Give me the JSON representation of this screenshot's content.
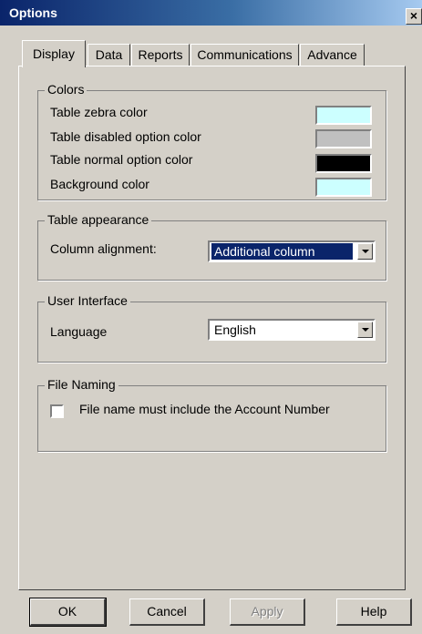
{
  "window": {
    "title": "Options",
    "close_glyph": "×"
  },
  "tabs": [
    {
      "label": "Display",
      "active": true
    },
    {
      "label": "Data",
      "active": false
    },
    {
      "label": "Reports",
      "active": false
    },
    {
      "label": "Communications",
      "active": false
    },
    {
      "label": "Advance",
      "active": false
    }
  ],
  "colors_group": {
    "title": "Colors",
    "rows": [
      {
        "label": "Table zebra color",
        "color": "#ccffff"
      },
      {
        "label": "Table disabled option color",
        "color": "#c0c0c0"
      },
      {
        "label": "Table normal option color",
        "color": "#000000"
      },
      {
        "label": "Background color",
        "color": "#ccffff"
      }
    ]
  },
  "table_appearance": {
    "title": "Table appearance",
    "column_alignment_label": "Column alignment:",
    "column_alignment_value": "Additional column"
  },
  "user_interface": {
    "title": "User Interface",
    "language_label": "Language",
    "language_value": "English"
  },
  "file_naming": {
    "title": "File Naming",
    "checkbox_label": "File name must include the Account Number",
    "checked": false
  },
  "buttons": {
    "ok": "OK",
    "cancel": "Cancel",
    "apply": "Apply",
    "help": "Help"
  }
}
